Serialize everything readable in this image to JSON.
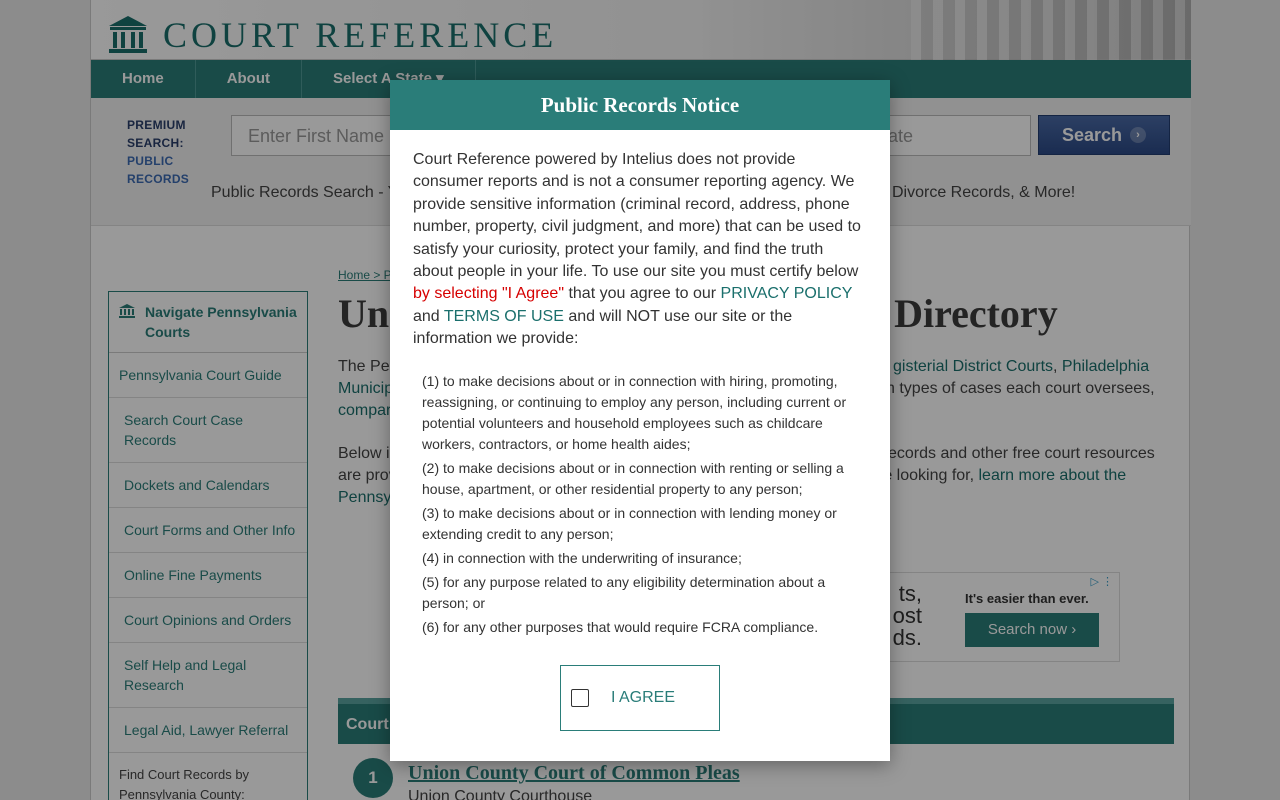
{
  "site": {
    "logo_text": "COURT REFERENCE"
  },
  "nav": {
    "items": [
      "Home",
      "About",
      "Select A State ▾"
    ]
  },
  "search": {
    "premium_line1": "PREMIUM",
    "premium_line2": "SEARCH:",
    "premium_line3": "PUBLIC",
    "premium_line4": "RECORDS",
    "first_name_placeholder": "Enter First Name",
    "state_placeholder": "ate",
    "button_label": "Search",
    "tagline_left": "Public Records Search - Y",
    "tagline_right": "Divorce Records, & More!"
  },
  "sidebar": {
    "title": "Navigate Pennsylvania Courts",
    "items": [
      "Pennsylvania Court Guide",
      "Search Court Case Records",
      "Dockets and Calendars",
      "Court Forms and Other Info",
      "Online Fine Payments",
      "Court Opinions and Orders",
      "Self Help and Legal Research",
      "Legal Aid, Lawyer Referral",
      "Find Court Records by Pennsylvania County:"
    ]
  },
  "main": {
    "breadcrumb": "Home > P",
    "title_left": "Uni",
    "title_right": "rt Directory",
    "p1_line1_left": "The Pen",
    "p1_line1_link1": "gisterial District Courts",
    "p1_line1_sep": ", ",
    "p1_line1_link2": "Philadelphia",
    "p1_line2_left": "Municip",
    "p1_line2_right": "ch types of cases each court oversees,",
    "p1_line3_left": "compar",
    "p2_line1_left": "Below i",
    "p2_line1_right": "ecords and other free court resources",
    "p2_line2_left": "are prov",
    "p2_line2_right": "re looking for, ",
    "p2_line2_link": "learn more about the",
    "p2_line3_left": "Pennsy"
  },
  "ad": {
    "left_line1": "ts,",
    "left_line2": "ost",
    "left_line3": "ds.",
    "headline": "It's easier than ever.",
    "button": "Search now ›",
    "icons": "▷ ⋮"
  },
  "section": {
    "title": "Court"
  },
  "court": {
    "number": "1",
    "name": "Union County Court of Common Pleas",
    "sub": "Union County Courthouse"
  },
  "modal": {
    "title": "Public Records Notice",
    "intro": "Court Reference powered by Intelius does not provide consumer reports and is not a consumer reporting agency. We provide sensitive information (criminal record, address, phone number, property, civil judgment, and more) that can be used to satisfy your curiosity, protect your family, and find the truth about people in your life. To use our site you must certify below ",
    "red_text": "by selecting \"I Agree\"",
    "mid_text": " that you agree to our ",
    "privacy_link": "PRIVACY POLICY",
    "and_text": " and ",
    "terms_link": "TERMS OF USE",
    "end_text": " and will NOT use our site or the information we provide:",
    "purposes": [
      "(1) to make decisions about or in connection with hiring, promoting, reassigning, or continuing to employ any person, including current or potential volunteers and household employees such as childcare workers, contractors, or home health aides;",
      "(2) to make decisions about or in connection with renting or selling a house, apartment, or other residential property to any person;",
      "(3) to make decisions about or in connection with lending money or extending credit to any person;",
      "(4) in connection with the underwriting of insurance;",
      "(5) for any purpose related to any eligibility determination about a person; or",
      "(6) for any other purposes that would require FCRA compliance."
    ],
    "agree_label": "I AGREE"
  }
}
